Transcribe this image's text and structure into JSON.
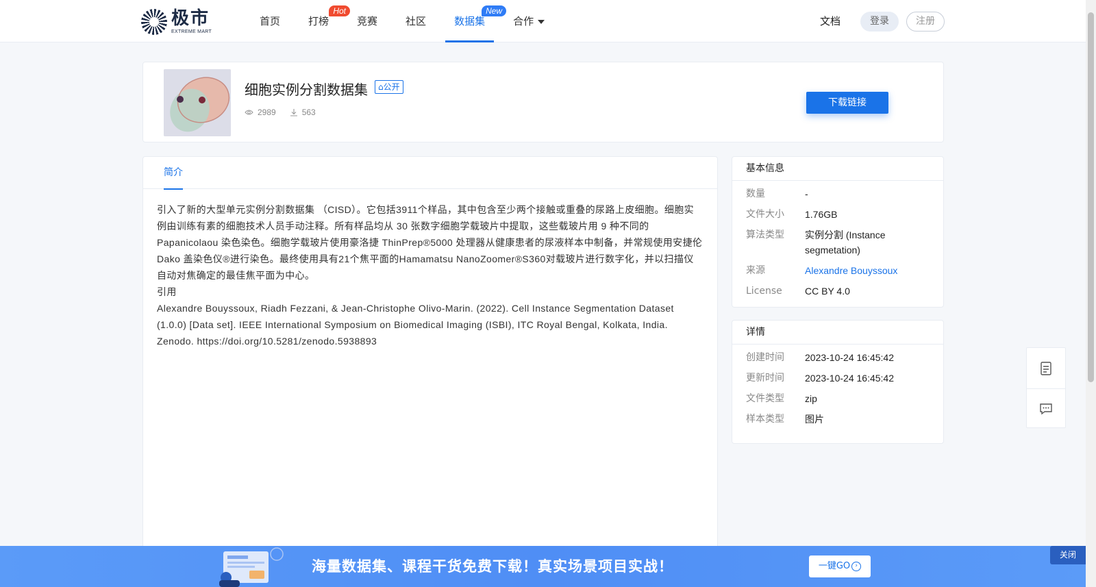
{
  "brand": {
    "name_cn": "极市",
    "name_en": "EXTREME MART"
  },
  "nav": {
    "items": [
      {
        "label": "首页"
      },
      {
        "label": "打榜",
        "badge": "Hot"
      },
      {
        "label": "竞赛"
      },
      {
        "label": "社区"
      },
      {
        "label": "数据集",
        "badge": "New",
        "active": true
      },
      {
        "label": "合作"
      }
    ],
    "docs": "文档",
    "login": "登录",
    "register": "注册"
  },
  "dataset": {
    "title": "细胞实例分割数据集",
    "tag": "公开",
    "views": "2989",
    "downloads": "563",
    "download_button": "下载链接"
  },
  "tabs": {
    "intro": "简介"
  },
  "intro": {
    "description": "引入了新的大型单元实例分割数据集 （CISD）。它包括3911个样品，其中包含至少两个接触或重叠的尿路上皮细胞。细胞实例由训练有素的细胞技术人员手动注释。所有样品均从 30 张数字细胞学载玻片中提取，这些载玻片用 9 种不同的 Papanicolaou 染色染色。细胞学载玻片使用豪洛捷 ThinPrep®5000 处理器从健康患者的尿液样本中制备，并常规使用安捷伦 Dako 盖染色仪®进行染色。最终使用具有21个焦平面的Hamamatsu NanoZoomer®S360对载玻片进行数字化，并以扫描仪自动对焦确定的最佳焦平面为中心。",
    "citation_heading": "引用",
    "citation": "Alexandre Bouyssoux, Riadh Fezzani, & Jean-Christophe Olivo-Marin. (2022). Cell Instance Segmentation Dataset (1.0.0) [Data set]. IEEE International Symposium on Biomedical Imaging (ISBI), ITC Royal Bengal, Kolkata, India. Zenodo. https://doi.org/10.5281/zenodo.5938893"
  },
  "basic_info": {
    "heading": "基本信息",
    "rows": [
      {
        "key": "数量",
        "value": "-"
      },
      {
        "key": "文件大小",
        "value": "1.76GB"
      },
      {
        "key": "算法类型",
        "value": "实例分割 (Instance segmetation)"
      },
      {
        "key": "来源",
        "value": "Alexandre Bouyssoux"
      },
      {
        "key": "License",
        "value": "CC BY 4.0"
      }
    ]
  },
  "details": {
    "heading": "详情",
    "rows": [
      {
        "key": "创建时间",
        "value": "2023-10-24 16:45:42"
      },
      {
        "key": "更新时间",
        "value": "2023-10-24 16:45:42"
      },
      {
        "key": "文件类型",
        "value": "zip"
      },
      {
        "key": "样本类型",
        "value": "图片"
      }
    ]
  },
  "float_tools": {
    "icons": [
      "document-icon",
      "chat-icon"
    ]
  },
  "banner": {
    "text": "海量数据集、课程干货免费下载！真实场景项目实战！",
    "button": "一键GO",
    "close": "关闭"
  },
  "colors": {
    "accent": "#1a73e8",
    "hot": "#f04b30",
    "new": "#2f7cf6",
    "banner": "#4f8ef5"
  }
}
